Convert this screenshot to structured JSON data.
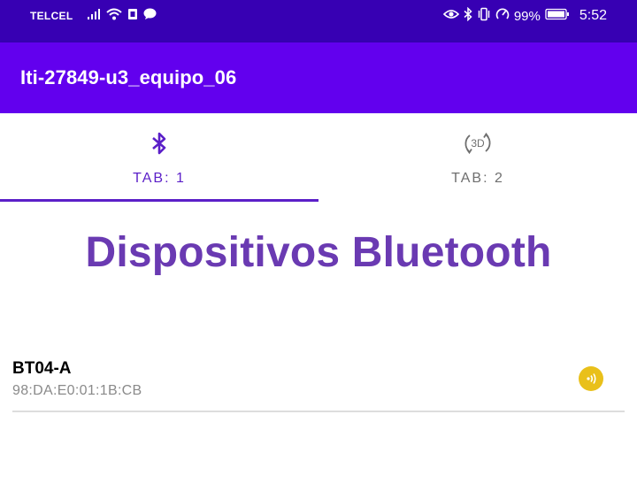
{
  "status_bar": {
    "carrier": "TELCEL",
    "battery_percent": "99%",
    "time": "5:52",
    "icons": [
      "signal-icon",
      "wifi-icon",
      "sim-icon",
      "message-icon",
      "eye-icon",
      "bluetooth-status-icon",
      "vibrate-icon",
      "data-saver-icon",
      "battery-icon"
    ]
  },
  "app_bar": {
    "title": "Iti-27849-u3_equipo_06"
  },
  "tabs": [
    {
      "label": "TAB: 1",
      "icon": "bluetooth-icon",
      "selected": true
    },
    {
      "label": "TAB: 2",
      "icon": "rotate-3d-icon",
      "selected": false
    }
  ],
  "tab2_icon_text": "3D",
  "main": {
    "heading": "Dispositivos Bluetooth"
  },
  "devices": [
    {
      "name": "BT04-A",
      "address": "98:DA:E0:01:1B:CB",
      "action_icon": "signal-icon"
    }
  ],
  "colors": {
    "status_bar": "#3700b3",
    "app_bar": "#6200ee",
    "accent": "#5b1fc8",
    "heading": "#6a3ab2",
    "badge": "#e9c01a"
  }
}
